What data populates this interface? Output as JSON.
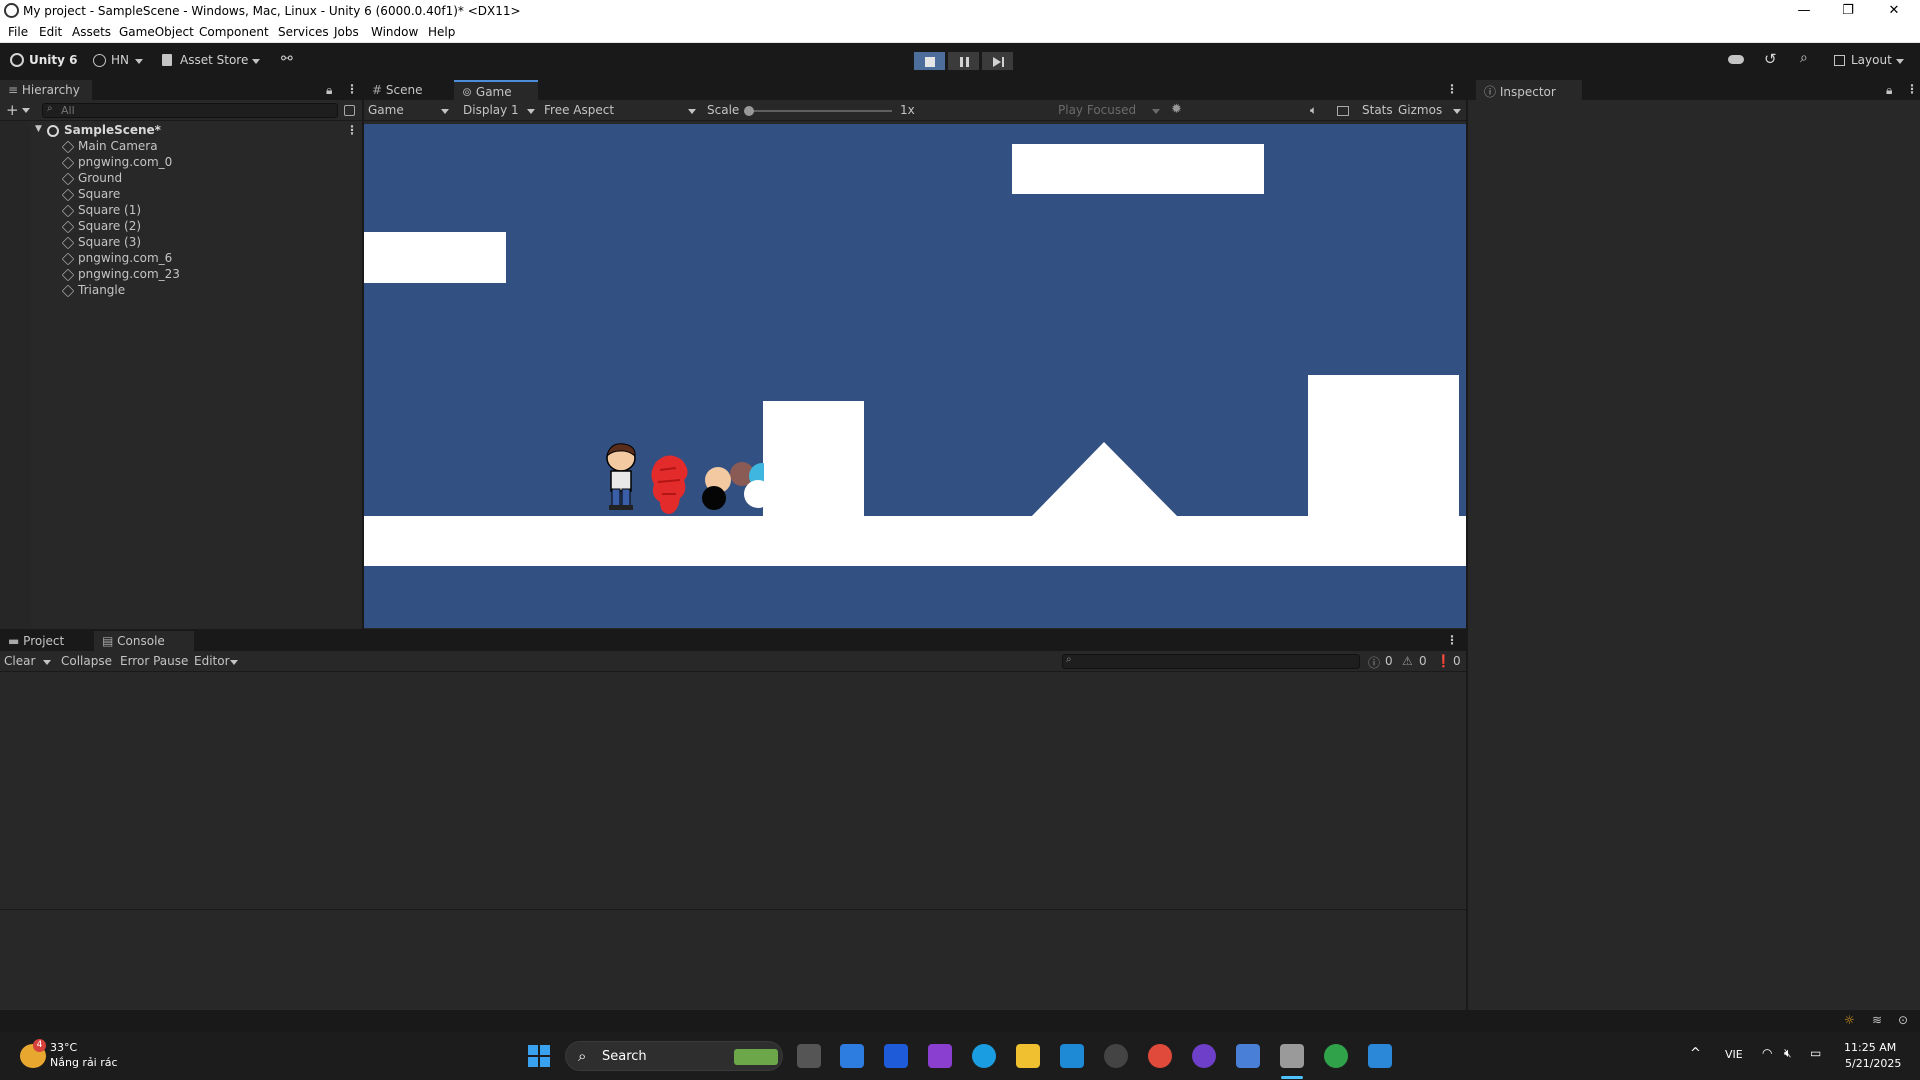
{
  "window": {
    "title": "My project - SampleScene - Windows, Mac, Linux - Unity 6 (6000.0.40f1)* <DX11>",
    "minimize_glyph": "—",
    "maximize_glyph": "❐",
    "close_glyph": "✕"
  },
  "menu": [
    "File",
    "Edit",
    "Assets",
    "GameObject",
    "Component",
    "Services",
    "Jobs",
    "Window",
    "Help"
  ],
  "toolbar": {
    "product": "Unity 6",
    "account": "HN",
    "asset_store": "Asset Store",
    "layout": "Layout"
  },
  "hierarchy": {
    "tab": "Hierarchy",
    "search_placeholder": "All",
    "scene": "SampleScene*",
    "items": [
      "Main Camera",
      "pngwing.com_0",
      "Ground",
      "Square",
      "Square (1)",
      "Square (2)",
      "Square (3)",
      "pngwing.com_6",
      "pngwing.com_23",
      "Triangle"
    ]
  },
  "center_tabs": {
    "scene": "Scene",
    "game": "Game"
  },
  "game_toolbar": {
    "mode": "Game",
    "display": "Display 1",
    "aspect": "Free Aspect",
    "scale_label": "Scale",
    "scale_value": "1x",
    "play_focused": "Play Focused",
    "stats": "Stats",
    "gizmos": "Gizmos"
  },
  "inspector": {
    "tab": "Inspector"
  },
  "bottom_tabs": {
    "project": "Project",
    "console": "Console"
  },
  "console": {
    "clear": "Clear",
    "collapse": "Collapse",
    "error_pause": "Error Pause",
    "editor": "Editor",
    "log_count": "0",
    "warning_count": "0",
    "error_count": "0"
  },
  "colors": {
    "game_background": "#335082",
    "platform": "#ffffff",
    "play_active": "#4d6d9a"
  },
  "taskbar": {
    "weather_temp": "33°C",
    "weather_desc": "Nắng rải rác",
    "weather_badge": "4",
    "search": "Search",
    "language": "VIE",
    "time": "11:25 AM",
    "date": "5/21/2025"
  }
}
